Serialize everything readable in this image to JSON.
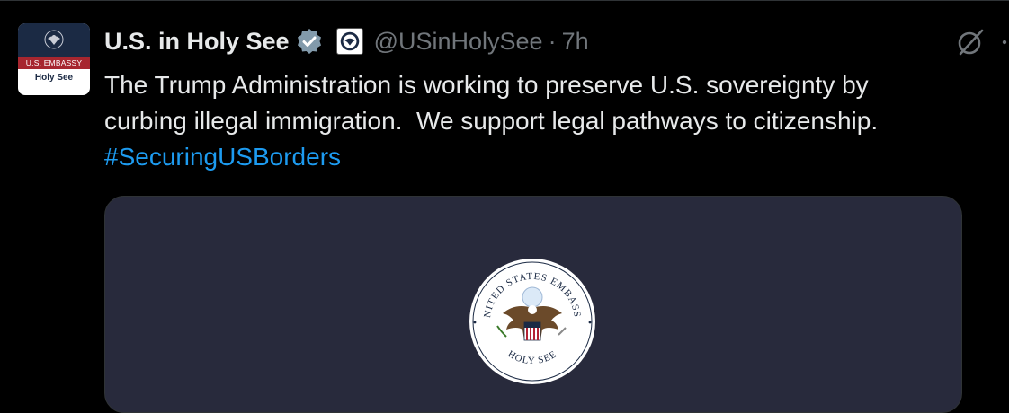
{
  "author": {
    "display_name": "U.S. in Holy See",
    "handle": "@USinHolySee",
    "separator": "·",
    "timestamp": "7h",
    "avatar": {
      "band_text": "U.S. EMBASSY",
      "sub_text": "Holy See"
    }
  },
  "tweet": {
    "lines": [
      "The Trump Administration is working to preserve U.S. sovereignty by",
      "curbing illegal immigration.  We support legal pathways to citizenship."
    ],
    "hashtag": "#SecuringUSBorders"
  },
  "media": {
    "seal_top_text": "UNITED STATES EMBASSY",
    "seal_bottom_text": "HOLY SEE"
  },
  "icons": {
    "verified": "verified-badge-icon",
    "affiliate": "affiliate-badge-icon",
    "grok": "grok-icon",
    "more": "more-icon"
  },
  "colors": {
    "background": "#000000",
    "primary_text": "#e7e9ea",
    "secondary_text": "#71767b",
    "link": "#1d9bf0",
    "media_bg": "#282a3c"
  }
}
